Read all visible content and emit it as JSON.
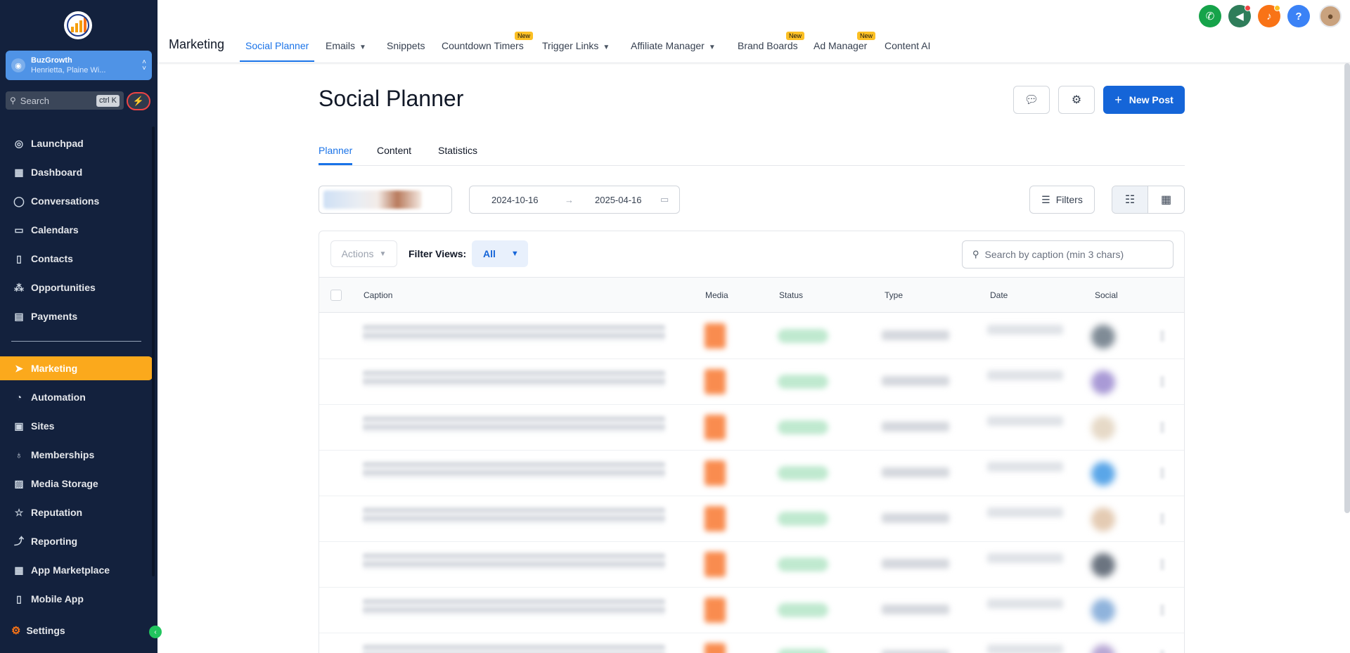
{
  "sidebar": {
    "account": {
      "name": "BuzGrowth",
      "location": "Henrietta, Plaine Wi..."
    },
    "search": {
      "label": "Search",
      "shortcut": "ctrl K"
    },
    "items": [
      {
        "label": "Launchpad",
        "icon": "rocket-icon"
      },
      {
        "label": "Dashboard",
        "icon": "grid-icon"
      },
      {
        "label": "Conversations",
        "icon": "chat-icon"
      },
      {
        "label": "Calendars",
        "icon": "calendar-icon"
      },
      {
        "label": "Contacts",
        "icon": "contacts-icon"
      },
      {
        "label": "Opportunities",
        "icon": "network-icon"
      },
      {
        "label": "Payments",
        "icon": "receipt-icon"
      }
    ],
    "items2": [
      {
        "label": "Marketing",
        "icon": "send-icon"
      },
      {
        "label": "Automation",
        "icon": "automation-icon"
      },
      {
        "label": "Sites",
        "icon": "sites-icon"
      },
      {
        "label": "Memberships",
        "icon": "membership-icon"
      },
      {
        "label": "Media Storage",
        "icon": "image-icon"
      },
      {
        "label": "Reputation",
        "icon": "star-icon"
      },
      {
        "label": "Reporting",
        "icon": "trend-icon"
      },
      {
        "label": "App Marketplace",
        "icon": "apps-icon"
      },
      {
        "label": "Mobile App",
        "icon": "mobile-icon"
      }
    ],
    "settings": "Settings",
    "active_color": "#fba91c"
  },
  "topnav": {
    "title": "Marketing",
    "links": [
      {
        "label": "Social Planner",
        "new": false,
        "dropdown": false
      },
      {
        "label": "Emails",
        "new": false,
        "dropdown": true
      },
      {
        "label": "Snippets",
        "new": false,
        "dropdown": false
      },
      {
        "label": "Countdown Timers",
        "new": true,
        "dropdown": false
      },
      {
        "label": "Trigger Links",
        "new": false,
        "dropdown": true
      },
      {
        "label": "Affiliate Manager",
        "new": false,
        "dropdown": true
      },
      {
        "label": "Brand Boards",
        "new": true,
        "dropdown": false
      },
      {
        "label": "Ad Manager",
        "new": true,
        "dropdown": false
      },
      {
        "label": "Content AI",
        "new": false,
        "dropdown": false
      }
    ],
    "new_badge": "New",
    "help_glyph": "?"
  },
  "page": {
    "title": "Social Planner",
    "new_post_label": "New Post",
    "tabs": [
      "Planner",
      "Content",
      "Statistics"
    ],
    "date_start": "2024-10-16",
    "date_end": "2025-04-16",
    "filters_label": "Filters",
    "actions_label": "Actions",
    "filter_views_label": "Filter Views:",
    "filter_views_value": "All",
    "search_placeholder": "Search by caption (min 3 chars)",
    "columns": [
      "Caption",
      "Media",
      "Status",
      "Type",
      "Date",
      "Social"
    ],
    "accent_color": "#1565d8"
  }
}
